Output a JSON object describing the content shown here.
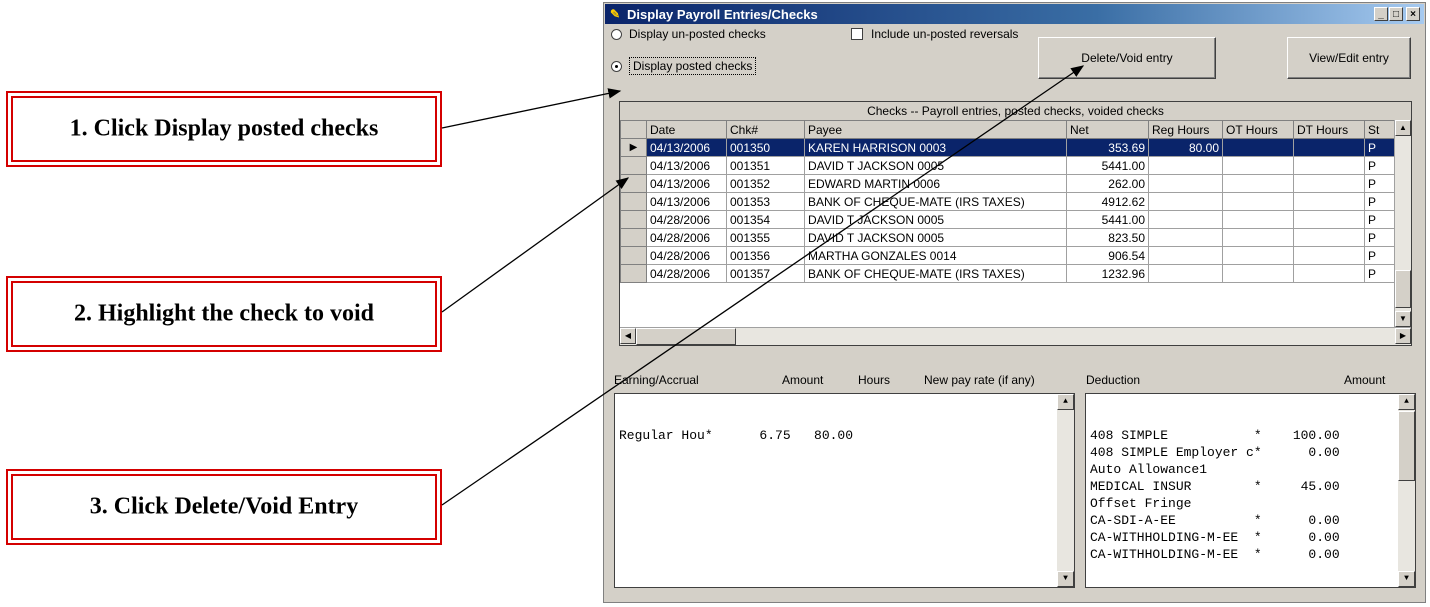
{
  "callouts": [
    {
      "text": "1. Click Display posted checks"
    },
    {
      "text": "2. Highlight the check to void"
    },
    {
      "text": "3. Click Delete/Void Entry"
    }
  ],
  "window": {
    "title": "Display Payroll Entries/Checks",
    "title_icon": "app-icon",
    "controls": {
      "minimize": "_",
      "maximize": "□",
      "close": "×"
    },
    "options": {
      "unposted_label": "Display un-posted checks",
      "unposted_checked": false,
      "include_reversals_label": "Include un-posted reversals",
      "include_reversals_checked": false,
      "posted_label": "Display posted checks",
      "posted_checked": true
    },
    "buttons": {
      "delete_void": "Delete/Void entry",
      "view_edit": "View/Edit entry"
    },
    "grid": {
      "caption": "Checks -- Payroll entries, posted checks, voided checks",
      "columns": [
        "Date",
        "Chk#",
        "Payee",
        "Net",
        "Reg Hours",
        "OT Hours",
        "DT Hours",
        "St"
      ],
      "selected_row": 0,
      "rows": [
        {
          "date": "04/13/2006",
          "chk": "001350",
          "payee": "KAREN HARRISON 0003",
          "net": "353.69",
          "reg": "80.00",
          "ot": "",
          "dt": "",
          "st": "P"
        },
        {
          "date": "04/13/2006",
          "chk": "001351",
          "payee": "DAVID T JACKSON 0005",
          "net": "5441.00",
          "reg": "",
          "ot": "",
          "dt": "",
          "st": "P"
        },
        {
          "date": "04/13/2006",
          "chk": "001352",
          "payee": "EDWARD MARTIN 0006",
          "net": "262.00",
          "reg": "",
          "ot": "",
          "dt": "",
          "st": "P"
        },
        {
          "date": "04/13/2006",
          "chk": "001353",
          "payee": "BANK OF CHEQUE-MATE (IRS TAXES)",
          "net": "4912.62",
          "reg": "",
          "ot": "",
          "dt": "",
          "st": "P"
        },
        {
          "date": "04/28/2006",
          "chk": "001354",
          "payee": "DAVID T JACKSON 0005",
          "net": "5441.00",
          "reg": "",
          "ot": "",
          "dt": "",
          "st": "P"
        },
        {
          "date": "04/28/2006",
          "chk": "001355",
          "payee": "DAVID T JACKSON 0005",
          "net": "823.50",
          "reg": "",
          "ot": "",
          "dt": "",
          "st": "P"
        },
        {
          "date": "04/28/2006",
          "chk": "001356",
          "payee": "MARTHA GONZALES 0014",
          "net": "906.54",
          "reg": "",
          "ot": "",
          "dt": "",
          "st": "P"
        },
        {
          "date": "04/28/2006",
          "chk": "001357",
          "payee": "BANK OF CHEQUE-MATE (IRS TAXES)",
          "net": "1232.96",
          "reg": "",
          "ot": "",
          "dt": "",
          "st": "P"
        }
      ]
    },
    "earnings": {
      "headers": {
        "name": "Earning/Accrual",
        "amount": "Amount",
        "hours": "Hours",
        "new_rate": "New pay rate (if any)"
      },
      "rows": [
        "Regular Hou*      6.75   80.00"
      ]
    },
    "deductions": {
      "headers": {
        "name": "Deduction",
        "amount": "Amount"
      },
      "rows": [
        "408 SIMPLE           *    100.00",
        "408 SIMPLE Employer c*      0.00",
        "Auto Allowance1",
        "MEDICAL INSUR        *     45.00",
        "Offset Fringe",
        "CA-SDI-A-EE          *      0.00",
        "CA-WITHHOLDING-M-EE  *      0.00",
        "CA-WITHHOLDING-M-EE  *      0.00"
      ]
    }
  }
}
